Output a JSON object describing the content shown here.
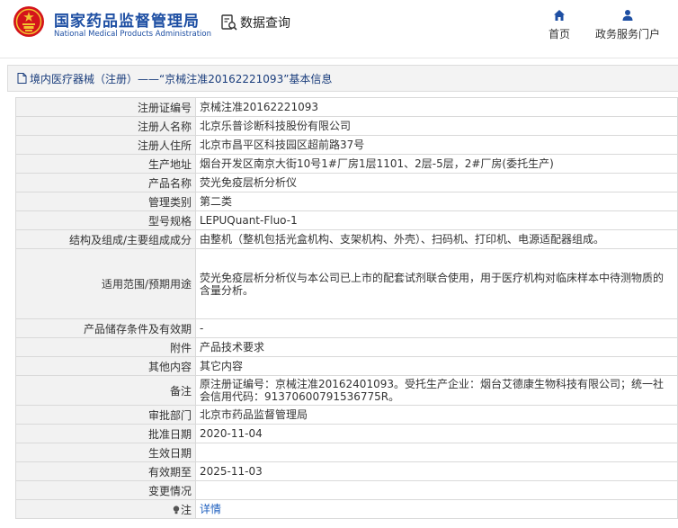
{
  "header": {
    "logo_cn": "国家药品监督管理局",
    "logo_en": "National Medical Products Administration",
    "search_label": "数据查询",
    "nav": [
      {
        "label": "首页",
        "icon": "home-icon"
      },
      {
        "label": "政务服务门户",
        "icon": "user-icon"
      }
    ],
    "brand_color": "#1e4fa3"
  },
  "title_bar": {
    "text": "境内医疗器械（注册）——“京械注准20162221093”基本信息"
  },
  "fields": [
    {
      "label": "注册证编号",
      "value": "京械注准20162221093"
    },
    {
      "label": "注册人名称",
      "value": "北京乐普诊断科技股份有限公司"
    },
    {
      "label": "注册人住所",
      "value": "北京市昌平区科技园区超前路37号"
    },
    {
      "label": "生产地址",
      "value": "烟台开发区南京大街10号1#厂房1层1101、2层-5层，2#厂房(委托生产)"
    },
    {
      "label": "产品名称",
      "value": "荧光免疫层析分析仪"
    },
    {
      "label": "管理类别",
      "value": "第二类"
    },
    {
      "label": "型号规格",
      "value": "LEPUQuant-Fluo-1"
    },
    {
      "label": "结构及组成/主要组成成分",
      "value": "由整机（整机包括光盒机构、支架机构、外壳）、扫码机、打印机、电源适配器组成。"
    },
    {
      "label": "适用范围/预期用途",
      "value": "荧光免疫层析分析仪与本公司已上市的配套试剂联合使用，用于医疗机构对临床样本中待测物质的含量分析。"
    },
    {
      "label": "产品储存条件及有效期",
      "value": "-"
    },
    {
      "label": "附件",
      "value": "产品技术要求"
    },
    {
      "label": "其他内容",
      "value": "其它内容"
    },
    {
      "label": "备注",
      "value": "原注册证编号：京械注准20162401093。受托生产企业：烟台艾德康生物科技有限公司；统一社会信用代码：91370600791536775R。"
    },
    {
      "label": "审批部门",
      "value": "北京市药品监督管理局"
    },
    {
      "label": "批准日期",
      "value": "2020-11-04"
    },
    {
      "label": "生效日期",
      "value": ""
    },
    {
      "label": "有效期至",
      "value": "2025-11-03"
    },
    {
      "label": "变更情况",
      "value": ""
    },
    {
      "label": "注",
      "value": "详情"
    }
  ]
}
